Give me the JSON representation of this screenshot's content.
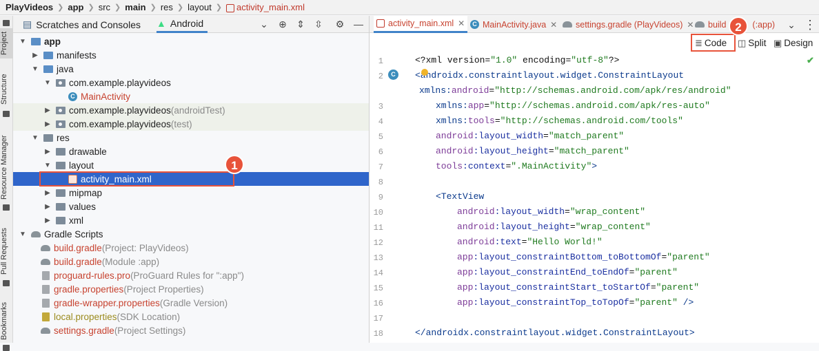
{
  "breadcrumb": [
    "PlayVideos",
    "app",
    "src",
    "main",
    "res",
    "layout",
    "activity_main.xml"
  ],
  "left_strip": {
    "project": "Project",
    "structure": "Structure",
    "resource_manager": "Resource Manager",
    "pull_requests": "Pull Requests",
    "bookmarks": "Bookmarks"
  },
  "project_panel": {
    "tab_scratches": "Scratches and Consoles",
    "tab_android": "Android"
  },
  "tree": [
    {
      "label": "app",
      "suffix": ""
    },
    {
      "label": "manifests",
      "suffix": ""
    },
    {
      "label": "java",
      "suffix": ""
    },
    {
      "label": "com.example.playvideos",
      "suffix": ""
    },
    {
      "label": "MainActivity",
      "suffix": ""
    },
    {
      "label": "com.example.playvideos",
      "suffix": " (androidTest)"
    },
    {
      "label": "com.example.playvideos",
      "suffix": " (test)"
    },
    {
      "label": "res",
      "suffix": ""
    },
    {
      "label": "drawable",
      "suffix": ""
    },
    {
      "label": "layout",
      "suffix": ""
    },
    {
      "label": "activity_main.xml",
      "suffix": ""
    },
    {
      "label": "mipmap",
      "suffix": ""
    },
    {
      "label": "values",
      "suffix": ""
    },
    {
      "label": "xml",
      "suffix": ""
    },
    {
      "label": "Gradle Scripts",
      "suffix": ""
    },
    {
      "label": "build.gradle",
      "suffix": " (Project: PlayVideos)"
    },
    {
      "label": "build.gradle",
      "suffix": " (Module :app)"
    },
    {
      "label": "proguard-rules.pro",
      "suffix": " (ProGuard Rules for \":app\")"
    },
    {
      "label": "gradle.properties",
      "suffix": " (Project Properties)"
    },
    {
      "label": "gradle-wrapper.properties",
      "suffix": " (Gradle Version)"
    },
    {
      "label": "local.properties",
      "suffix": " (SDK Location)"
    },
    {
      "label": "settings.gradle",
      "suffix": " (Project Settings)"
    }
  ],
  "editor_tabs": [
    {
      "label": "activity_main.xml"
    },
    {
      "label": "MainActivity.java"
    },
    {
      "label": "settings.gradle (PlayVideos)"
    },
    {
      "label": "build",
      "tail": "(:app)"
    }
  ],
  "editor_modes": {
    "code": "Code",
    "split": "Split",
    "design": "Design"
  },
  "callouts": {
    "one": "1",
    "two": "2"
  },
  "line_numbers": [
    "1",
    "2",
    "3",
    "4",
    "5",
    "6",
    "7",
    "8",
    "9",
    "10",
    "11",
    "12",
    "13",
    "14",
    "15",
    "16",
    "17",
    "18"
  ],
  "code": {
    "l1": {
      "a": "<?xml version=",
      "b": "\"1.0\"",
      "c": " encoding=",
      "d": "\"utf-8\"",
      "e": "?>"
    },
    "l2": {
      "a": "<androidx.constraintlayout.widget.ConstraintLayout"
    },
    "l2b": {
      "ns": "xmlns:",
      "attr": "android",
      "eq": "=",
      "val": "\"http://schemas.android.com/apk/res/android\""
    },
    "l3": {
      "ns": "xmlns:",
      "attr": "app",
      "eq": "=",
      "val": "\"http://schemas.android.com/apk/res-auto\""
    },
    "l4": {
      "ns": "xmlns:",
      "attr": "tools",
      "eq": "=",
      "val": "\"http://schemas.android.com/tools\""
    },
    "l5": {
      "ns": "android",
      "attr": ":layout_width",
      "eq": "=",
      "val": "\"match_parent\""
    },
    "l6": {
      "ns": "android",
      "attr": ":layout_height",
      "eq": "=",
      "val": "\"match_parent\""
    },
    "l7": {
      "ns": "tools",
      "attr": ":context",
      "eq": "=",
      "val": "\".MainActivity\"",
      "end": ">"
    },
    "l9": {
      "a": "<TextView"
    },
    "l10": {
      "ns": "android",
      "attr": ":layout_width",
      "eq": "=",
      "val": "\"wrap_content\""
    },
    "l11": {
      "ns": "android",
      "attr": ":layout_height",
      "eq": "=",
      "val": "\"wrap_content\""
    },
    "l12": {
      "ns": "android",
      "attr": ":text",
      "eq": "=",
      "val": "\"Hello World!\""
    },
    "l13": {
      "ns": "app",
      "attr": ":layout_constraintBottom_toBottomOf",
      "eq": "=",
      "val": "\"parent\""
    },
    "l14": {
      "ns": "app",
      "attr": ":layout_constraintEnd_toEndOf",
      "eq": "=",
      "val": "\"parent\""
    },
    "l15": {
      "ns": "app",
      "attr": ":layout_constraintStart_toStartOf",
      "eq": "=",
      "val": "\"parent\""
    },
    "l16": {
      "ns": "app",
      "attr": ":layout_constraintTop_toTopOf",
      "eq": "=",
      "val": "\"parent\"",
      "end": " />"
    },
    "l18": {
      "a": "</androidx.constraintlayout.widget.ConstraintLayout>"
    }
  },
  "colors": {
    "accent": "#2f65ca",
    "callout": "#e8533a",
    "file_red": "#c7422f"
  }
}
